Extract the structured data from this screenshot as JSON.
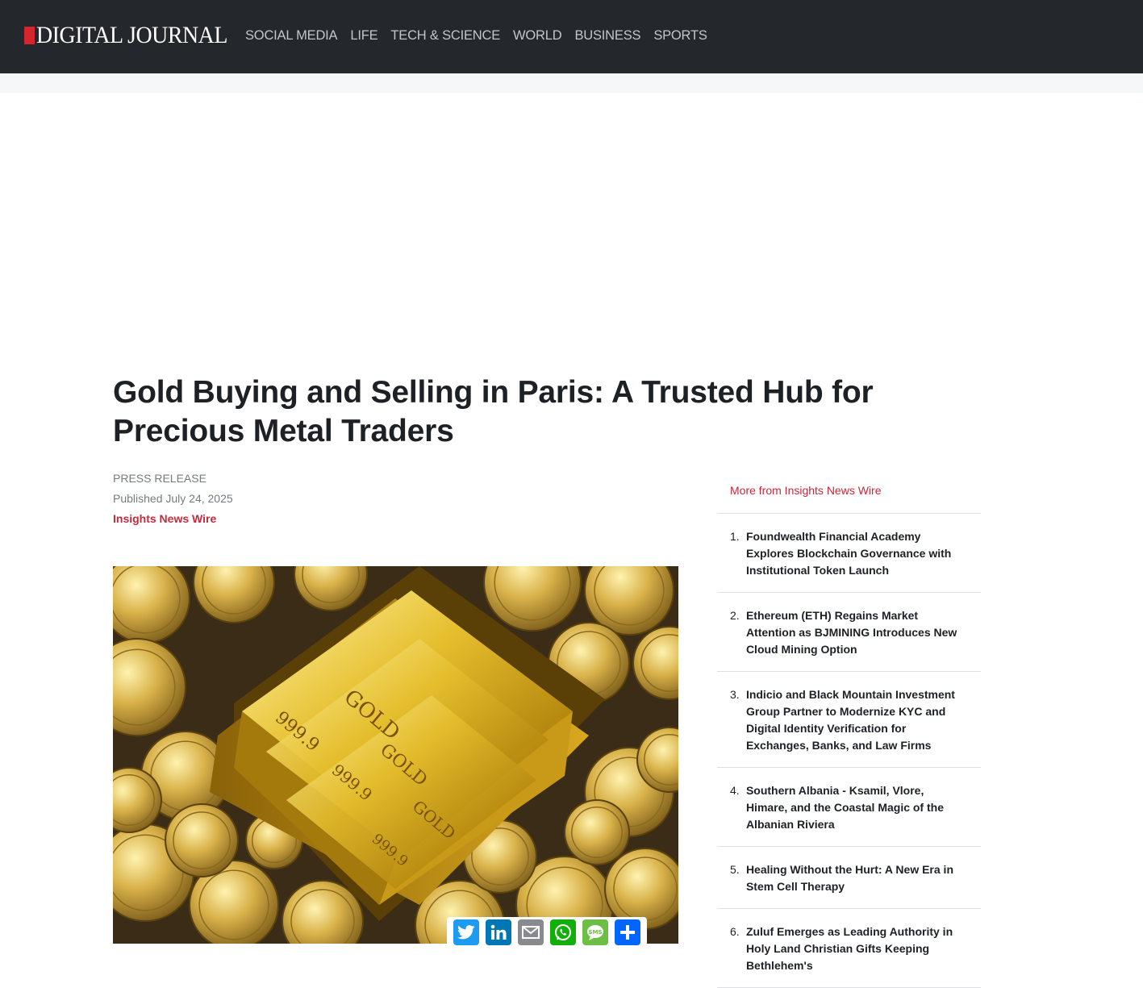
{
  "header": {
    "logo_text": "DIGITAL JOURNAL",
    "nav": [
      "SOCIAL MEDIA",
      "LIFE",
      "TECH & SCIENCE",
      "WORLD",
      "BUSINESS",
      "SPORTS"
    ]
  },
  "article": {
    "title": "Gold Buying and Selling in Paris: A Trusted Hub for Precious Metal Traders",
    "category": "PRESS RELEASE",
    "published": "Published July 24, 2025",
    "author": "Insights News Wire",
    "hero_image": "gold bars stacked on a pile of gold coins"
  },
  "share": {
    "buttons": [
      {
        "name": "twitter",
        "icon": "twitter-icon",
        "color": "#1d9bf0"
      },
      {
        "name": "linkedin",
        "icon": "linkedin-icon",
        "color": "#0077b5"
      },
      {
        "name": "email",
        "icon": "email-icon",
        "color": "#888a8d"
      },
      {
        "name": "whatsapp",
        "icon": "whatsapp-icon",
        "color": "#12af0a"
      },
      {
        "name": "sms",
        "icon": "sms-icon",
        "color": "#6cbe45"
      },
      {
        "name": "share",
        "icon": "share-plus-icon",
        "color": "#0166ff"
      }
    ]
  },
  "sidebar": {
    "title": "More from Insights News Wire",
    "items": [
      {
        "num": "1.",
        "text": "Foundwealth Financial Academy Explores Blockchain Governance with Institutional Token Launch"
      },
      {
        "num": "2.",
        "text": "Ethereum (ETH) Regains Market Attention as BJMINING Introduces New Cloud Mining Option"
      },
      {
        "num": "3.",
        "text": "Indicio and Black Mountain Investment Group Partner to Modernize KYC and Digital Identity Verification for Exchanges, Banks, and Law Firms"
      },
      {
        "num": "4.",
        "text": "Southern Albania - Ksamil, Vlore, Himare, and the Coastal Magic of the Albanian Riviera"
      },
      {
        "num": "5.",
        "text": "Healing Without the Hurt: A New Era in Stem Cell Therapy"
      },
      {
        "num": "6.",
        "text": "Zuluf Emerges as Leading Authority in Holy Land Christian Gifts Keeping Bethlehem's"
      }
    ]
  },
  "colors": {
    "header_bg": "#24272b",
    "brand_red": "#d4262c",
    "link_red": "#c8283b"
  }
}
